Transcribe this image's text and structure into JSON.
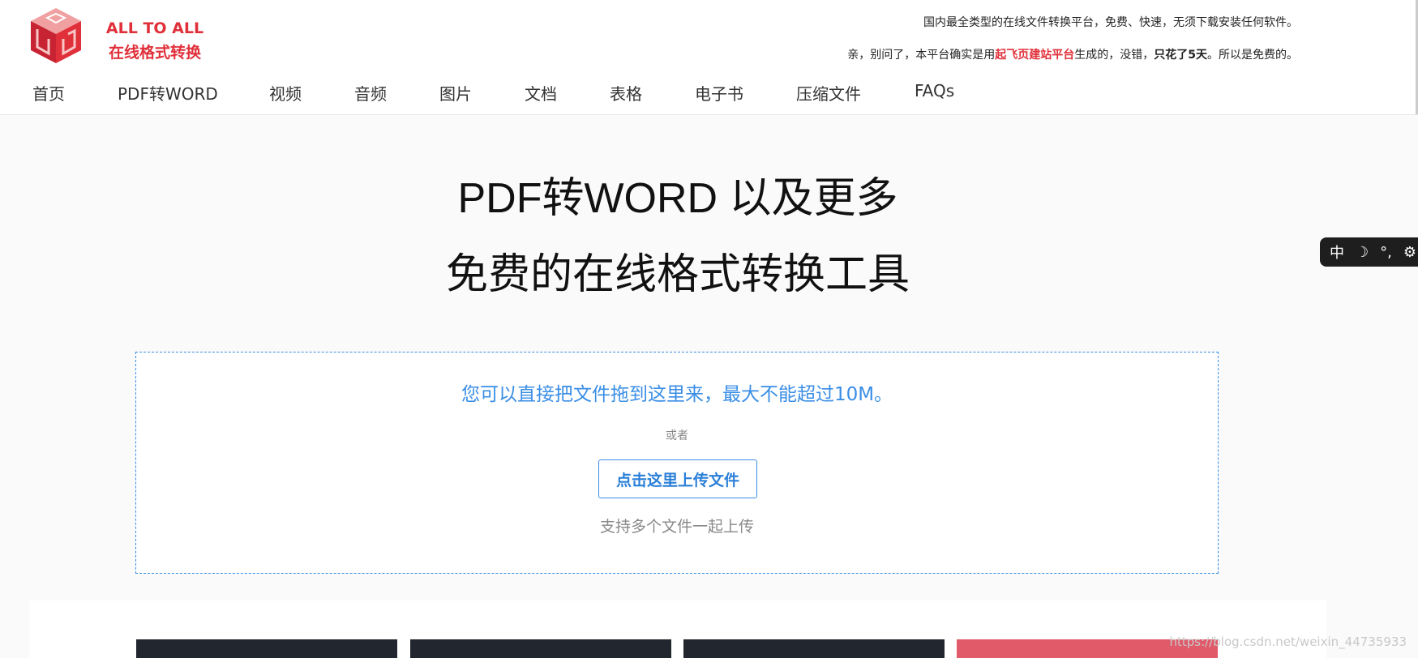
{
  "brand": {
    "name_en": "ALL TO ALL",
    "name_cn": "在线格式转换"
  },
  "notice": {
    "line1": "国内最全类型的在线文件转换平台，免费、快速，无须下载安装任何软件。",
    "line2_pre": "亲，别问了，本平台确实是用",
    "line2_highlight": "起飞页建站平台",
    "line2_mid": "生成的，没错，",
    "line2_bold": "只花了5天",
    "line2_post": "。所以是免费的。"
  },
  "nav": {
    "items": [
      {
        "label": "首页"
      },
      {
        "label": "PDF转WORD"
      },
      {
        "label": "视频"
      },
      {
        "label": "音频"
      },
      {
        "label": "图片"
      },
      {
        "label": "文档"
      },
      {
        "label": "表格"
      },
      {
        "label": "电子书"
      },
      {
        "label": "压缩文件"
      },
      {
        "label": "FAQs"
      }
    ]
  },
  "hero": {
    "title": "PDF转WORD 以及更多",
    "subtitle": "免费的在线格式转换工具"
  },
  "dropzone": {
    "drag_text": "您可以直接把文件拖到这里来，最大不能超过10M。",
    "or_text": "或者",
    "upload_label": "点击这里上传文件",
    "multi_text": "支持多个文件一起上传"
  },
  "ime": {
    "lang": "中",
    "moon": "☽",
    "punct": "°,",
    "gear": "⚙"
  },
  "watermark": "https://blog.csdn.net/weixin_44735933",
  "colors": {
    "brand_red": "#e0303a",
    "accent_blue": "#3a8ee6"
  }
}
